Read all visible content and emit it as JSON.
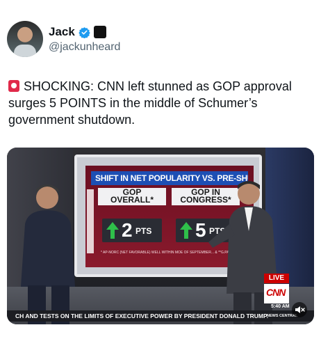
{
  "author": {
    "name": "Jack",
    "handle": "@jackunheard",
    "verified": true,
    "avatar_icon": "avatar-photo",
    "affiliate_badge_icon": "affiliate-badge-icon"
  },
  "post": {
    "text": "SHOCKING: CNN left stunned as GOP approval surges 5 POINTS in the middle of Schumer’s government shutdown.",
    "leading_emoji": "siren-emoji"
  },
  "media": {
    "screen": {
      "headline": "SHIFT IN NET POPULARITY VS. PRE-SHUTDOWN",
      "panels": [
        {
          "label_line1": "GOP",
          "label_line2": "OVERALL*",
          "value": "2",
          "unit": "PTS"
        },
        {
          "label_line1": "GOP IN",
          "label_line2": "CONGRESS*",
          "value": "5",
          "unit": "PTS"
        }
      ],
      "footnote": "* AP-NORC (NET FAVORABLE) WELL WITHIN MOE OF SEPTEMBER... & **G.PAI"
    },
    "live_label": "LIVE",
    "network": "CNN",
    "time": "5:40 AM",
    "ticker": "CH AND TESTS ON THE LIMITS OF EXECUTIVE POWER BY PRESIDENT DONALD TRUMP.",
    "ticker_tag": "NEWS CENTRAL",
    "colors": {
      "cnn_red": "#cc0000",
      "arrow_green": "#2fbf4a",
      "headline_blue": "#1d4fb4"
    }
  }
}
